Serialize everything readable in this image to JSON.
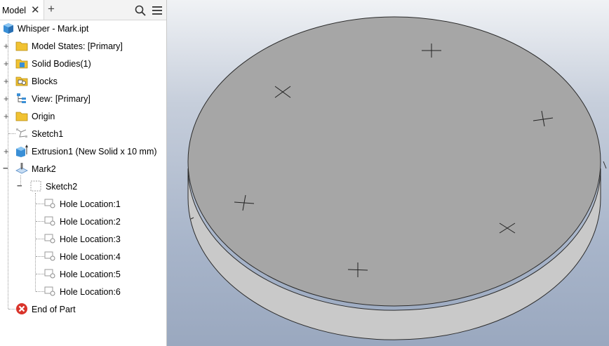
{
  "browser": {
    "tab_label": "Model",
    "tab_close": "✕",
    "add_tab": "+",
    "tree": [
      {
        "id": "root",
        "label": "Whisper - Mark.ipt",
        "icon": "part-icon"
      },
      {
        "id": "model-states",
        "label": "Model States: [Primary]",
        "icon": "folder-icon",
        "expander": "+"
      },
      {
        "id": "solid-bodies",
        "label": "Solid Bodies(1)",
        "icon": "solid-bodies-folder-icon",
        "expander": "+"
      },
      {
        "id": "blocks",
        "label": "Blocks",
        "icon": "blocks-folder-icon",
        "expander": "+"
      },
      {
        "id": "view",
        "label": "View: [Primary]",
        "icon": "view-icon",
        "expander": "+"
      },
      {
        "id": "origin",
        "label": "Origin",
        "icon": "folder-icon",
        "expander": "+"
      },
      {
        "id": "sketch1",
        "label": "Sketch1",
        "icon": "sketch-icon"
      },
      {
        "id": "extrusion1",
        "label": "Extrusion1 (New Solid x 10 mm)",
        "icon": "extrusion-icon",
        "expander": "+"
      },
      {
        "id": "mark2",
        "label": "Mark2",
        "icon": "mark-icon",
        "expander": "−"
      },
      {
        "id": "sketch2",
        "label": "Sketch2",
        "icon": "sketch-plane-icon",
        "expander": "−"
      },
      {
        "id": "hole1",
        "label": "Hole Location:1",
        "icon": "hole-location-icon"
      },
      {
        "id": "hole2",
        "label": "Hole Location:2",
        "icon": "hole-location-icon"
      },
      {
        "id": "hole3",
        "label": "Hole Location:3",
        "icon": "hole-location-icon"
      },
      {
        "id": "hole4",
        "label": "Hole Location:4",
        "icon": "hole-location-icon"
      },
      {
        "id": "hole5",
        "label": "Hole Location:5",
        "icon": "hole-location-icon"
      },
      {
        "id": "hole6",
        "label": "Hole Location:6",
        "icon": "hole-location-icon"
      },
      {
        "id": "end",
        "label": "End of Part",
        "icon": "end-of-part-icon"
      }
    ]
  },
  "colors": {
    "disc_top": "#a6a6a6",
    "disc_side": "#c9c9c9",
    "folder": "#f1c232",
    "part_blue": "#3a8fd6",
    "end_red": "#d9342b"
  }
}
